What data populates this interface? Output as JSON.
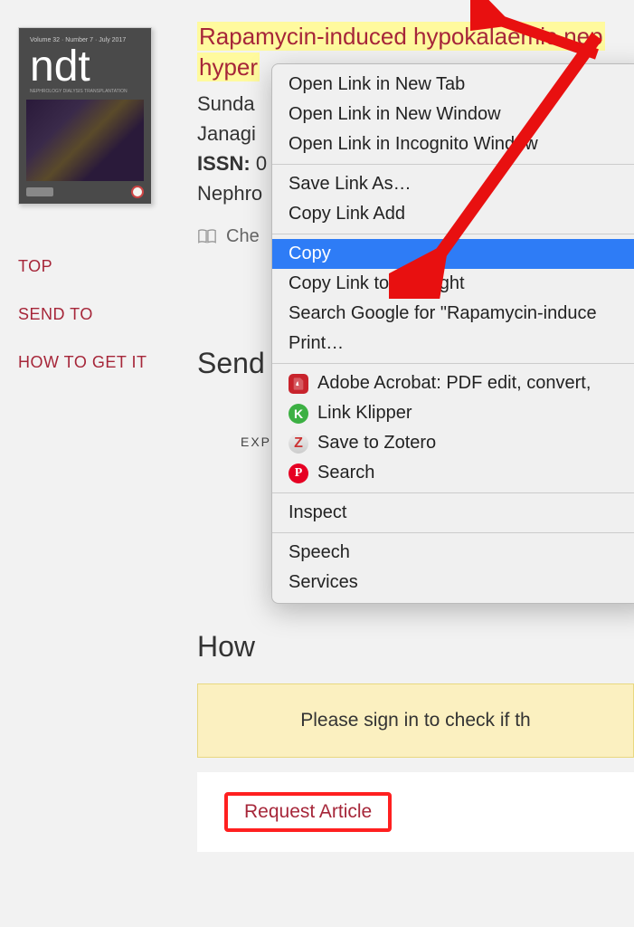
{
  "cover": {
    "top": "Volume 32 · Number 7 · July 2017",
    "logo": "ndt",
    "sub": "NEPHROLOGY DIALYSIS TRANSPLANTATION"
  },
  "nav": {
    "top": "TOP",
    "send": "SEND TO",
    "how": "HOW TO GET IT"
  },
  "title": {
    "line1": "Rapamycin-induced hypokalaemic nep",
    "line2": "hyper"
  },
  "meta": {
    "authors1": "Sunda",
    "authors2": "Janagi",
    "issn_label": "ISSN:",
    "issn_val": "0",
    "journal": "Nephro"
  },
  "check": "Che",
  "send_heading": "Send",
  "exp": "EXP",
  "how_heading": "How",
  "signin": "Please sign in to check if th",
  "request": "Request Article",
  "menu": {
    "open_tab": "Open Link in New Tab",
    "open_win": "Open Link in New Window",
    "open_inc": "Open Link in Incognito Window",
    "save_as": "Save Link As…",
    "copy_addr": "Copy Link Add",
    "copy": "Copy",
    "copy_hl": "Copy Link to Highlight",
    "search": "Search Google for \"Rapamycin-induce",
    "print": "Print…",
    "acrobat": "Adobe Acrobat: PDF edit, convert,",
    "klipper": "Link Klipper",
    "zotero": "Save to Zotero",
    "pinterest": "Search",
    "inspect": "Inspect",
    "speech": "Speech",
    "services": "Services"
  }
}
